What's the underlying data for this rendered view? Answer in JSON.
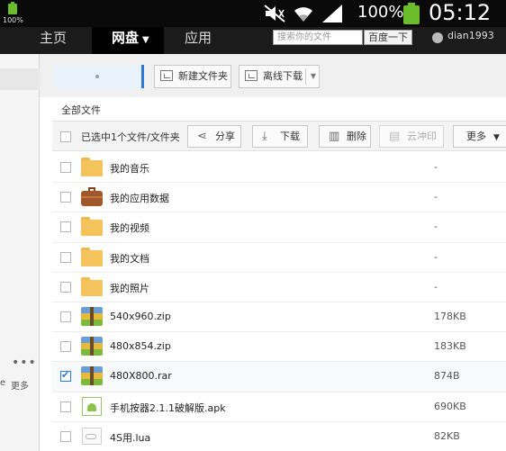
{
  "statusbar": {
    "small_battery_label": "100%",
    "battery_percent": "100%",
    "time": "05:12"
  },
  "nav": {
    "home": "主页",
    "disk": "网盘",
    "apps": "应用",
    "search_placeholder": "搜索你的文件",
    "search_button": "百度一下",
    "username": "dian1993"
  },
  "leftpanel": {
    "dots": "•••",
    "more": "更多",
    "cut_char": "e"
  },
  "toolbar": {
    "new_folder": "新建文件夹",
    "offline_download": "离线下载"
  },
  "breadcrumb": "全部文件",
  "actionbar": {
    "selection": "已选中1个文件/文件夹",
    "share": "分享",
    "download": "下载",
    "delete": "删除",
    "cloud_print": "云冲印",
    "more": "更多"
  },
  "files": [
    {
      "name": "我的音乐",
      "size": "-",
      "icon": "folder",
      "checked": false
    },
    {
      "name": "我的应用数据",
      "size": "-",
      "icon": "briefcase",
      "checked": false
    },
    {
      "name": "我的视频",
      "size": "-",
      "icon": "folder",
      "checked": false
    },
    {
      "name": "我的文档",
      "size": "-",
      "icon": "folder",
      "checked": false
    },
    {
      "name": "我的照片",
      "size": "-",
      "icon": "folder",
      "checked": false
    },
    {
      "name": "540x960.zip",
      "size": "178KB",
      "icon": "archive",
      "checked": false
    },
    {
      "name": "480x854.zip",
      "size": "183KB",
      "icon": "archive",
      "checked": false
    },
    {
      "name": "480X800.rar",
      "size": "874B",
      "icon": "archive",
      "checked": true
    },
    {
      "name": "手机按器2.1.1破解版.apk",
      "size": "690KB",
      "icon": "apk",
      "checked": false
    },
    {
      "name": "4S用.lua",
      "size": "82KB",
      "icon": "file",
      "checked": false
    }
  ],
  "colors": {
    "accent": "#2c7ad6",
    "folder": "#f5c35c",
    "battery": "#6bbd2c",
    "statusbar": "#0a0a0a"
  }
}
